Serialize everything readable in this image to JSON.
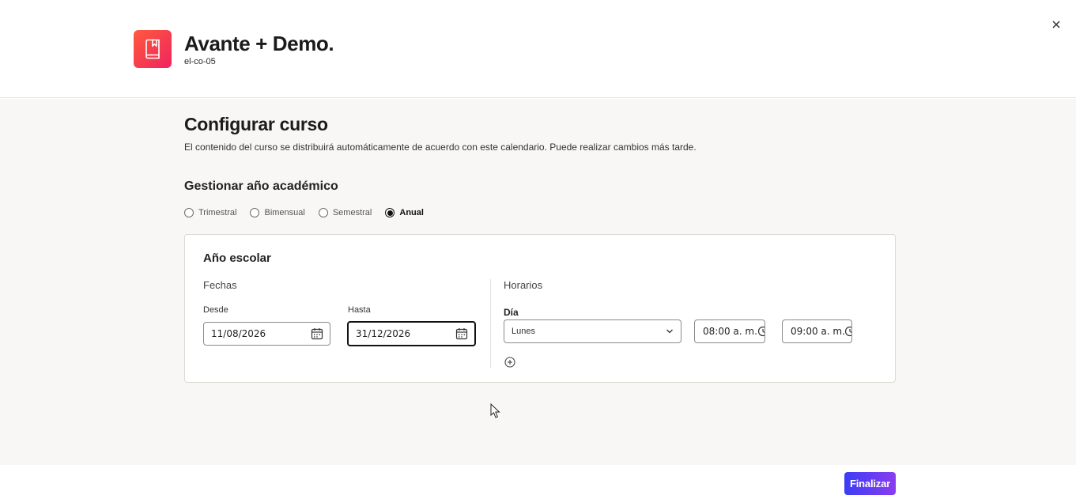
{
  "header": {
    "course_title": "Avante + Demo.",
    "course_code": "el-co-05",
    "logo_icon": "book-icon",
    "logo_colors": [
      "#ff5a3c",
      "#f0245f"
    ],
    "close_icon": "close-icon"
  },
  "main": {
    "title": "Configurar curso",
    "subtitle": "El contenido del curso se distribuirá automáticamente de acuerdo con este calendario. Puede realizar cambios más tarde.",
    "academic_year": {
      "title": "Gestionar año académico",
      "options": [
        {
          "label": "Trimestral",
          "selected": false
        },
        {
          "label": "Bimensual",
          "selected": false
        },
        {
          "label": "Semestral",
          "selected": false
        },
        {
          "label": "Anual",
          "selected": true
        }
      ]
    },
    "school_year": {
      "title": "Año escolar",
      "dates": {
        "title": "Fechas",
        "from_label": "Desde",
        "from_value": "11/08/2026",
        "to_label": "Hasta",
        "to_value": "31/12/2026",
        "calendar_icon": "calendar-icon"
      },
      "schedules": {
        "title": "Horarios",
        "day_label": "Día",
        "day_value": "Lunes",
        "start_time": "08:00 a. m.",
        "end_time": "09:00 a. m.",
        "add_icon": "plus-circle-icon"
      }
    }
  },
  "footer": {
    "finish_label": "Finalizar",
    "finish_colors": [
      "#3b3df5",
      "#8a3df0"
    ]
  }
}
